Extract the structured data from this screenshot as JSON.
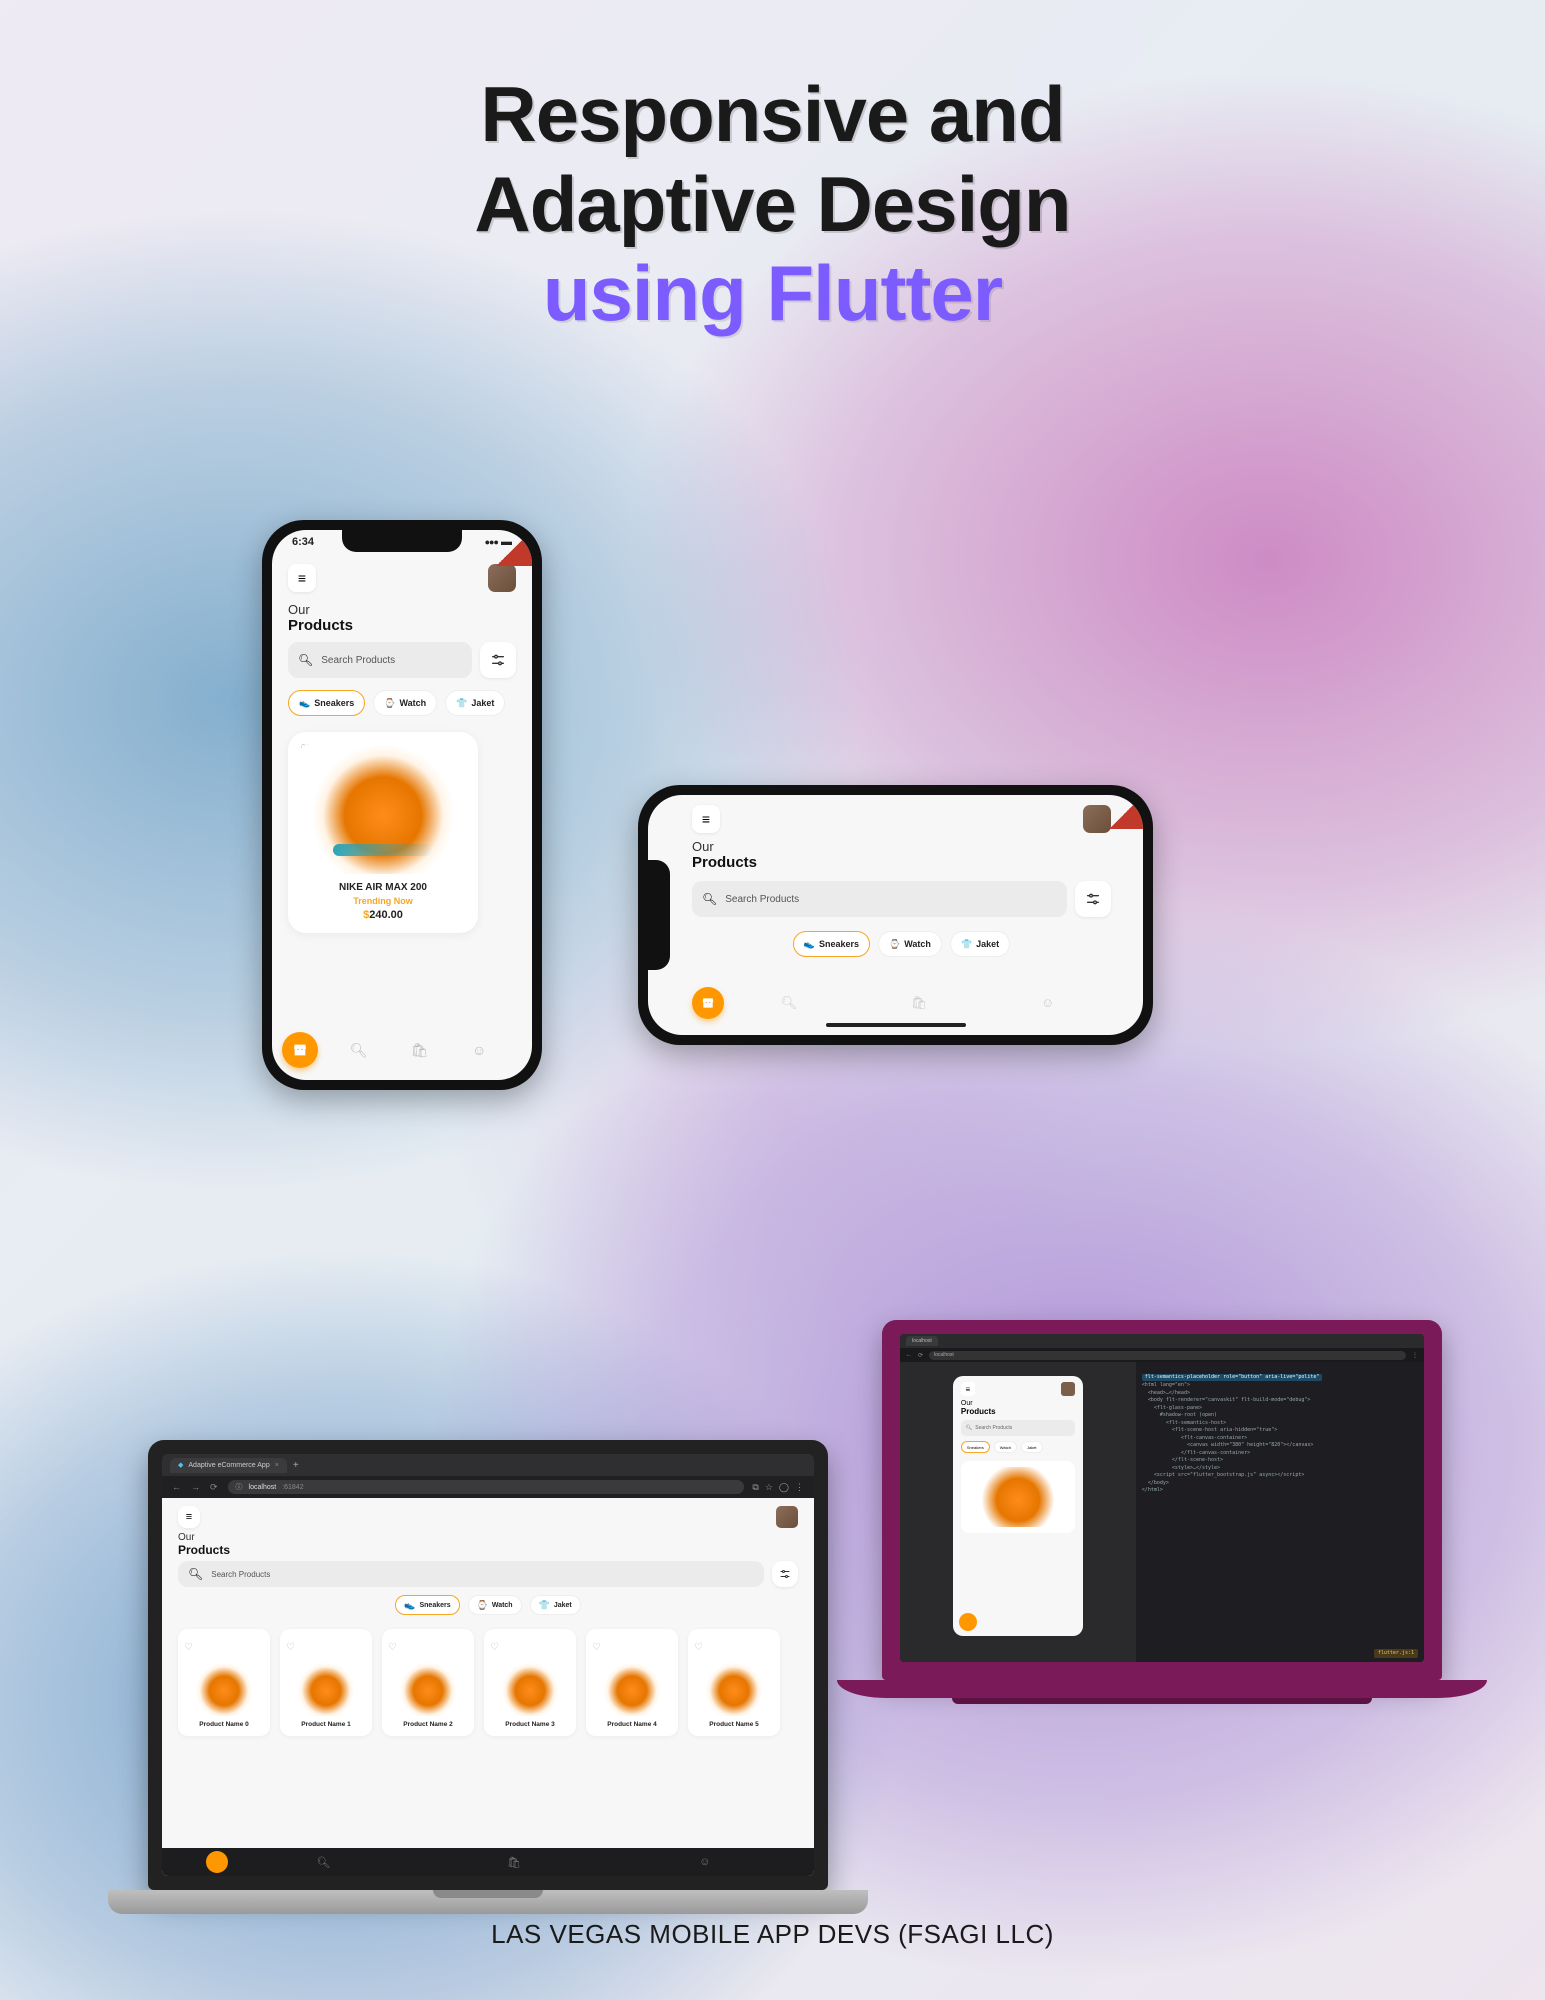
{
  "title": {
    "line1": "Responsive and",
    "line2": "Adaptive Design",
    "accent": "using Flutter"
  },
  "footer": "LAS VEGAS MOBILE APP DEVS (FSAGI LLC)",
  "app": {
    "status_time": "6:34",
    "heading_light": "Our",
    "heading_bold": "Products",
    "search_placeholder": "Search Products",
    "chips": {
      "sneakers": "Sneakers",
      "watch": "Watch",
      "jacket": "Jaket"
    },
    "featured": {
      "name": "NIKE AIR MAX 200",
      "subtitle": "Trending Now",
      "currency": "$",
      "price": "240.00"
    },
    "grid_names": [
      "Product Name 0",
      "Product Name 1",
      "Product Name 2",
      "Product Name 3",
      "Product Name 4",
      "Product Name 5"
    ]
  },
  "browser": {
    "tab_title": "Adaptive eCommerce App",
    "url_host": "localhost",
    "url_port": ":61842"
  },
  "devtools": {
    "tab_title": "localhost",
    "highlighted": "flt-semantics-placeholder role=\"button\" aria-live=\"polite\"",
    "lines": [
      "<html lang=\"en\">",
      "  <head>…</head>",
      "  <body flt-renderer=\"canvaskit\" flt-build-mode=\"debug\">",
      "    <flt-glass-pane>",
      "      #shadow-root (open)",
      "        <flt-semantics-host>",
      "          <flt-scene-host aria-hidden=\"true\">",
      "             <flt-canvas-container>",
      "               <canvas width=\"380\" height=\"820\"></canvas>",
      "             </flt-canvas-container>",
      "          </flt-scene-host>",
      "          <style>…</style>",
      "    <script src=\"flutter_bootstrap.js\" async></script>",
      "  </body>",
      "</html>"
    ],
    "footer_hint": "flutter.js:1"
  }
}
